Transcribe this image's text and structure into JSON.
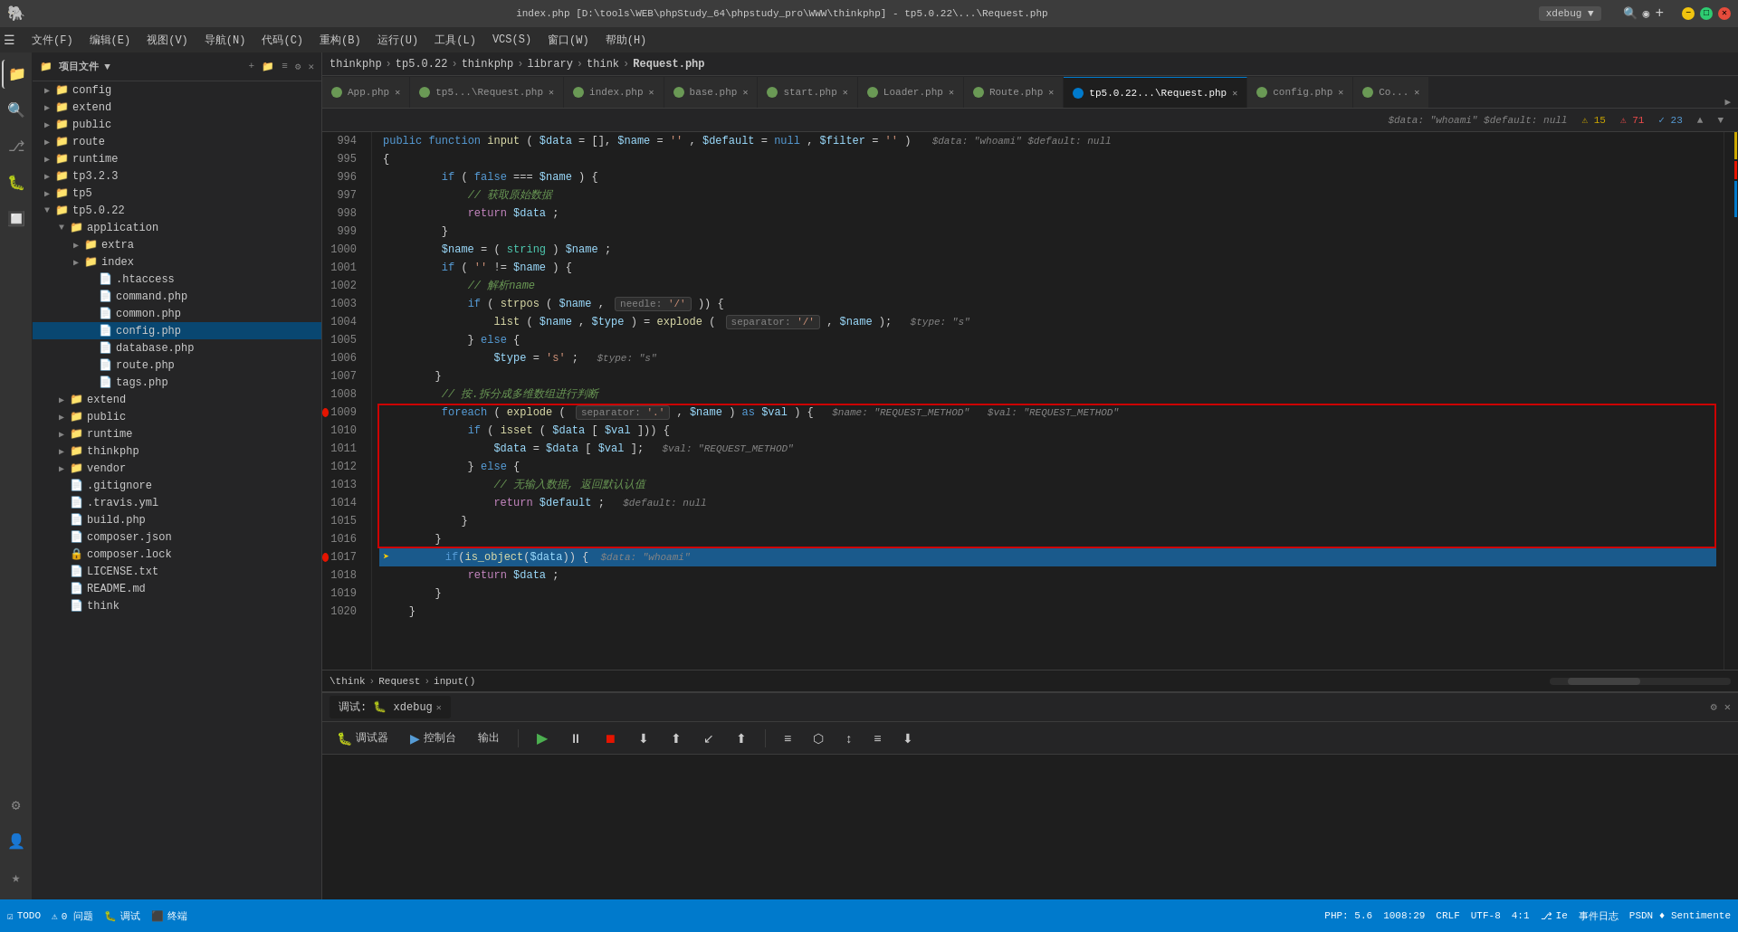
{
  "titlebar": {
    "title": "index.php [D:\\tools\\WEB\\phpStudy_64\\phpstudy_pro\\WWW\\thinkphp] - tp5.0.22\\...\\Request.php",
    "menu_items": [
      "文件(F)",
      "编辑(E)",
      "视图(V)",
      "导航(N)",
      "代码(C)",
      "重构(B)",
      "运行(U)",
      "工具(L)",
      "VCS(S)",
      "窗口(W)",
      "帮助(H)"
    ],
    "right_label": "xdebug",
    "php_icon": "🐘"
  },
  "breadcrumb": {
    "items": [
      "thinkphp",
      "tp5.0.22",
      "thinkphp",
      "library",
      "think",
      "Request.php"
    ]
  },
  "tabs": [
    {
      "name": "App.php",
      "type": "php",
      "modified": false,
      "active": false
    },
    {
      "name": "tp5...\\Request.php",
      "type": "php",
      "modified": false,
      "active": false
    },
    {
      "name": "index.php",
      "type": "php",
      "modified": false,
      "active": false
    },
    {
      "name": "base.php",
      "type": "php",
      "modified": false,
      "active": false
    },
    {
      "name": "start.php",
      "type": "php",
      "modified": false,
      "active": false
    },
    {
      "name": "Loader.php",
      "type": "php",
      "modified": false,
      "active": false
    },
    {
      "name": "Route.php",
      "type": "php",
      "modified": false,
      "active": false
    },
    {
      "name": "tp5.0.22...\\Request.php",
      "type": "php",
      "modified": false,
      "active": true
    },
    {
      "name": "config.php",
      "type": "php",
      "modified": false,
      "active": false
    },
    {
      "name": "Co...",
      "type": "php",
      "modified": false,
      "active": false
    }
  ],
  "sidebar": {
    "title": "项目文件",
    "tree": [
      {
        "level": 0,
        "expanded": true,
        "name": "config",
        "type": "folder"
      },
      {
        "level": 0,
        "expanded": true,
        "name": "extend",
        "type": "folder"
      },
      {
        "level": 0,
        "expanded": true,
        "name": "public",
        "type": "folder"
      },
      {
        "level": 0,
        "expanded": true,
        "name": "route",
        "type": "folder"
      },
      {
        "level": 0,
        "expanded": true,
        "name": "runtime",
        "type": "folder"
      },
      {
        "level": 0,
        "expanded": false,
        "name": "tp3.2.3",
        "type": "folder"
      },
      {
        "level": 0,
        "expanded": false,
        "name": "tp5",
        "type": "folder"
      },
      {
        "level": 0,
        "expanded": true,
        "name": "tp5.0.22",
        "type": "folder"
      },
      {
        "level": 1,
        "expanded": true,
        "name": "application",
        "type": "folder"
      },
      {
        "level": 2,
        "expanded": true,
        "name": "extra",
        "type": "folder"
      },
      {
        "level": 2,
        "expanded": true,
        "name": "index",
        "type": "folder"
      },
      {
        "level": 2,
        "name": ".htaccess",
        "type": "file",
        "icon": "ht"
      },
      {
        "level": 2,
        "name": "command.php",
        "type": "php"
      },
      {
        "level": 2,
        "name": "common.php",
        "type": "php"
      },
      {
        "level": 2,
        "name": "config.php",
        "type": "php",
        "selected": true
      },
      {
        "level": 2,
        "name": "database.php",
        "type": "php"
      },
      {
        "level": 2,
        "name": "route.php",
        "type": "php"
      },
      {
        "level": 2,
        "name": "tags.php",
        "type": "php"
      },
      {
        "level": 1,
        "expanded": false,
        "name": "extend",
        "type": "folder"
      },
      {
        "level": 1,
        "expanded": false,
        "name": "public",
        "type": "folder"
      },
      {
        "level": 1,
        "expanded": false,
        "name": "runtime",
        "type": "folder"
      },
      {
        "level": 1,
        "expanded": false,
        "name": "thinkphp",
        "type": "folder"
      },
      {
        "level": 1,
        "expanded": false,
        "name": "vendor",
        "type": "folder"
      },
      {
        "level": 1,
        "name": ".gitignore",
        "type": "git"
      },
      {
        "level": 1,
        "name": ".travis.yml",
        "type": "yml"
      },
      {
        "level": 1,
        "name": "build.php",
        "type": "php"
      },
      {
        "level": 1,
        "name": "composer.json",
        "type": "json"
      },
      {
        "level": 1,
        "name": "composer.lock",
        "type": "lock"
      },
      {
        "level": 1,
        "name": "LICENSE.txt",
        "type": "txt"
      },
      {
        "level": 1,
        "name": "README.md",
        "type": "md"
      },
      {
        "level": 1,
        "name": "think",
        "type": "file"
      }
    ]
  },
  "code_info": {
    "param_hint": "$data: \"whoami\"  $default: null",
    "warnings": "15",
    "errors": "71",
    "marks": "23"
  },
  "editor": {
    "lines": [
      {
        "num": 994,
        "content": "    public function input($data = [], $name = '', $default = null, $filter = '')",
        "hint": "$data: \"whoami\"  $default: null",
        "highlighted": false
      },
      {
        "num": 995,
        "content": "    {",
        "highlighted": false
      },
      {
        "num": 996,
        "content": "        if (false === $name) {",
        "highlighted": false
      },
      {
        "num": 997,
        "content": "            // 获取原始数据",
        "highlighted": false
      },
      {
        "num": 998,
        "content": "            return $data;",
        "highlighted": false
      },
      {
        "num": 999,
        "content": "        }",
        "highlighted": false
      },
      {
        "num": 1000,
        "content": "        $name = (string) $name;",
        "highlighted": false
      },
      {
        "num": 1001,
        "content": "        if ('' != $name) {",
        "highlighted": false
      },
      {
        "num": 1002,
        "content": "            // 解析name",
        "highlighted": false
      },
      {
        "num": 1003,
        "content": "            if (strpos($name,",
        "hint_inline": "needle: '/'",
        "content2": ")) {",
        "highlighted": false
      },
      {
        "num": 1004,
        "content": "                list($name, $type) = explode(",
        "hint_inline": "separator: '/'",
        "content2": ", $name);  $type: \"s\"",
        "highlighted": false
      },
      {
        "num": 1005,
        "content": "            } else {",
        "highlighted": false
      },
      {
        "num": 1006,
        "content": "                $type = 's';",
        "hint_inline": "$type: \"s\"",
        "highlighted": false
      },
      {
        "num": 1007,
        "content": "        }",
        "highlighted": false
      },
      {
        "num": 1008,
        "content": "        // 按.拆分成多维数组进行判断",
        "highlighted": false,
        "red_box_start": true
      },
      {
        "num": 1009,
        "content": "        foreach (explode(",
        "hint_inline": "separator: '.'",
        "content2": ", $name) as $val) {   $name: \"REQUEST_METHOD\"   $val: \"REQUEST_METHOD\"",
        "highlighted": false,
        "in_red_box": true
      },
      {
        "num": 1010,
        "content": "            if (isset($data[$val])) {",
        "highlighted": false,
        "in_red_box": true
      },
      {
        "num": 1011,
        "content": "                $data = $data[$val];",
        "hint_inline": "$val: \"REQUEST_METHOD\"",
        "highlighted": false,
        "in_red_box": true
      },
      {
        "num": 1012,
        "content": "            } else {",
        "highlighted": false,
        "in_red_box": true
      },
      {
        "num": 1013,
        "content": "                // 无输入数据, 返回默认认值",
        "highlighted": false,
        "in_red_box": true
      },
      {
        "num": 1014,
        "content": "                return $default;",
        "hint_inline": "$default: null",
        "highlighted": false,
        "in_red_box": true
      },
      {
        "num": 1015,
        "content": "            }",
        "highlighted": false,
        "in_red_box": true
      },
      {
        "num": 1016,
        "content": "        }",
        "highlighted": false,
        "red_box_end": true
      },
      {
        "num": 1017,
        "content": "        if (is_object($data)) {",
        "hint_inline": "$data: \"whoami\"",
        "highlighted": true,
        "breakpoint": true
      },
      {
        "num": 1018,
        "content": "            return $data;",
        "highlighted": false
      },
      {
        "num": 1019,
        "content": "        }",
        "highlighted": false
      },
      {
        "num": 1020,
        "content": "    }",
        "highlighted": false
      }
    ]
  },
  "bottom_breadcrumb": {
    "items": [
      "\\think",
      "Request",
      "input()"
    ]
  },
  "debug": {
    "panel_title": "xdebug",
    "tabs": [
      "调试器",
      "控制台",
      "输出"
    ],
    "active_tab": "调试器",
    "toolbar_buttons": [
      "▶",
      "⏸",
      "⏹",
      "⬇",
      "⬆",
      "⬇",
      "↙",
      "⬆",
      "≡",
      "⬡",
      "↕",
      "≡",
      "⬇"
    ]
  },
  "statusbar": {
    "left_items": [
      "☑ TODO",
      "⚠ 0 问题",
      "🐛 调试",
      "⬛ 终端"
    ],
    "right_items": [
      "PHP: 5.6",
      "1008:29",
      "CRLF",
      "UTF-8",
      "4:1",
      "事件日志"
    ],
    "git_branch": "Ie",
    "bottom_text": "PSDN ♦ Sentimente"
  },
  "icons": {
    "folder": "▶",
    "folder_open": "▼",
    "file": "📄",
    "php": "🐘",
    "settings": "⚙",
    "search": "🔍",
    "close": "✕",
    "warning": "⚠",
    "error": "✗",
    "breakpoint": "●",
    "arrow_right": "→"
  }
}
